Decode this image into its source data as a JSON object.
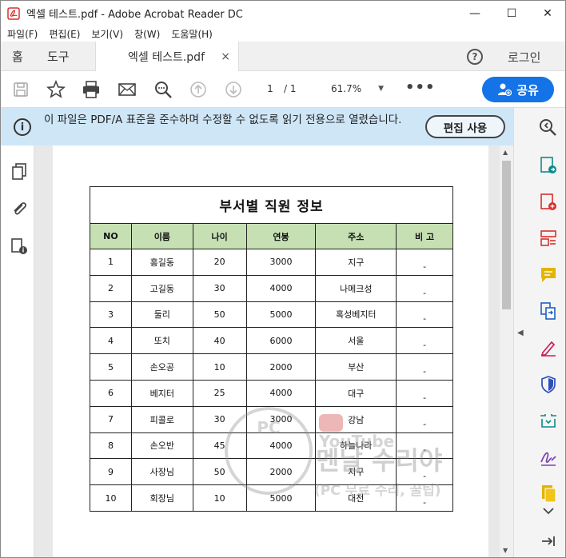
{
  "window": {
    "title": "엑셀 테스트.pdf - Adobe Acrobat Reader DC",
    "minimize": "—",
    "maximize": "☐",
    "close": "✕"
  },
  "menu": [
    "파일(F)",
    "편집(E)",
    "보기(V)",
    "창(W)",
    "도움말(H)"
  ],
  "tabs": {
    "home": "홈",
    "tools": "도구",
    "document": "엑셀 테스트.pdf",
    "close": "×",
    "help": "?",
    "login": "로그인"
  },
  "toolbar": {
    "page_current": "1",
    "page_total": "/ 1",
    "zoom": "61.7%",
    "more": "•••",
    "share": "공유"
  },
  "notice": {
    "message": "이 파일은 PDF/A 표준을 준수하며 수정할 수 없도록 읽기 전용으로 열렸습니다.",
    "button": "편집 사용"
  },
  "sheet": {
    "title": "부서별 직원 정보",
    "headers": [
      "NO",
      "이름",
      "나이",
      "연봉",
      "주소",
      "비 고"
    ],
    "rows": [
      [
        "1",
        "홍길동",
        "20",
        "3000",
        "지구",
        "-"
      ],
      [
        "2",
        "고길동",
        "30",
        "4000",
        "나메크성",
        "-"
      ],
      [
        "3",
        "둘리",
        "50",
        "5000",
        "혹성베지터",
        "-"
      ],
      [
        "4",
        "또치",
        "40",
        "6000",
        "서울",
        "-"
      ],
      [
        "5",
        "손오공",
        "10",
        "2000",
        "부산",
        "-"
      ],
      [
        "6",
        "베지터",
        "25",
        "4000",
        "대구",
        "-"
      ],
      [
        "7",
        "피콜로",
        "30",
        "3000",
        "강남",
        "-"
      ],
      [
        "8",
        "손오반",
        "45",
        "4000",
        "하늘나라",
        "-"
      ],
      [
        "9",
        "사장님",
        "50",
        "2000",
        "지구",
        "-"
      ],
      [
        "10",
        "회장님",
        "10",
        "5000",
        "대전",
        "-"
      ]
    ]
  },
  "watermark": {
    "badge": "PC",
    "channel": "YouTube",
    "name": "멘날 수리야",
    "tagline": "(PC 무료 수리, 꿀팁)"
  },
  "colors": {
    "accent": "#1473e6",
    "notice_bg": "#cfe6f7",
    "header_fill": "#c6e0b4",
    "pdf_red": "#d9302c"
  }
}
